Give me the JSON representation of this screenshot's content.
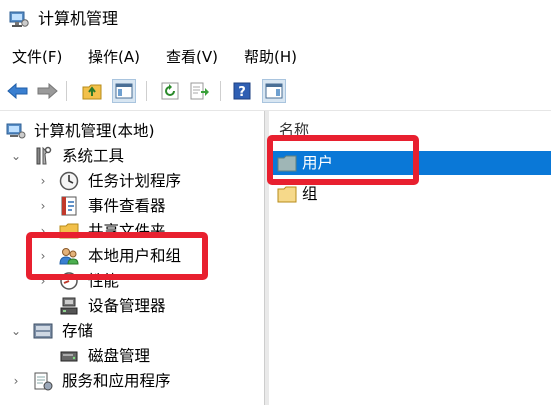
{
  "window": {
    "title": "计算机管理"
  },
  "menubar": {
    "items": [
      "文件(F)",
      "操作(A)",
      "查看(V)",
      "帮助(H)"
    ]
  },
  "toolbar": {
    "buttons": [
      "back-icon",
      "forward-icon",
      "up-folder-icon",
      "show-hide-tree-icon",
      "refresh-icon",
      "export-list-icon",
      "help-icon",
      "show-action-pane-icon"
    ]
  },
  "tree": {
    "root": "计算机管理(本地)",
    "system_tools": "系统工具",
    "task_scheduler": "任务计划程序",
    "event_viewer": "事件查看器",
    "shared_folders": "共享文件夹",
    "local_users_groups": "本地用户和组",
    "performance": "性能",
    "device_manager": "设备管理器",
    "storage": "存储",
    "disk_management": "磁盘管理",
    "services_apps": "服务和应用程序"
  },
  "list": {
    "column_name": "名称",
    "items": [
      "用户",
      "组"
    ]
  },
  "colors": {
    "selection": "#0a78d7",
    "highlight": "#e8202f"
  }
}
